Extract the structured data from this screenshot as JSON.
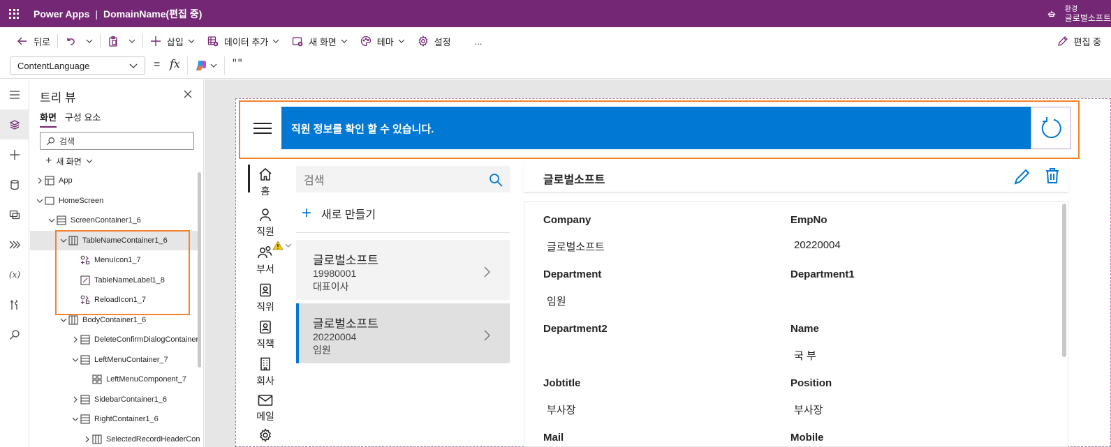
{
  "titlebar": {
    "app_name": "Power Apps",
    "separator": "|",
    "doc_name": "DomainName(편집 중)",
    "env_label": "환경",
    "env_name": "글로벌소프트"
  },
  "toolbar": {
    "back": "뒤로",
    "insert": "삽입",
    "add_data": "데이터 추가",
    "new_screen": "새 화면",
    "theme": "테마",
    "settings": "설정",
    "more": "...",
    "editing": "편집 중"
  },
  "formula": {
    "property": "ContentLanguage",
    "equals": "=",
    "fx": "fx",
    "value": "\"\""
  },
  "tree": {
    "title": "트리 뷰",
    "tabs": [
      "화면",
      "구성 요소"
    ],
    "search_placeholder": "검색",
    "new_screen": "새 화면",
    "rows": [
      {
        "label": "App",
        "indent": 0,
        "chev": "right",
        "icon": "app"
      },
      {
        "label": "HomeScreen",
        "indent": 0,
        "chev": "down",
        "icon": "screen"
      },
      {
        "label": "ScreenContainer1_6",
        "indent": 1,
        "chev": "down",
        "icon": "vcontainer"
      },
      {
        "label": "TableNameContainer1_6",
        "indent": 2,
        "chev": "down",
        "icon": "hcontainer",
        "selected": true
      },
      {
        "label": "MenuIcon1_7",
        "indent": 3,
        "chev": "",
        "icon": "iconctl"
      },
      {
        "label": "TableNameLabel1_8",
        "indent": 3,
        "chev": "",
        "icon": "label"
      },
      {
        "label": "ReloadIcon1_7",
        "indent": 3,
        "chev": "",
        "icon": "iconctl"
      },
      {
        "label": "BodyContainer1_6",
        "indent": 2,
        "chev": "down",
        "icon": "hcontainer"
      },
      {
        "label": "DeleteConfirmDialogContainer",
        "indent": 3,
        "chev": "right",
        "icon": "vcontainer"
      },
      {
        "label": "LeftMenuContainer_7",
        "indent": 3,
        "chev": "down",
        "icon": "vcontainer"
      },
      {
        "label": "LeftMenuComponent_7",
        "indent": 4,
        "chev": "",
        "icon": "component"
      },
      {
        "label": "SidebarContainer1_6",
        "indent": 3,
        "chev": "right",
        "icon": "vcontainer"
      },
      {
        "label": "RightContainer1_6",
        "indent": 3,
        "chev": "down",
        "icon": "vcontainer"
      },
      {
        "label": "SelectedRecordHeaderCon",
        "indent": 4,
        "chev": "right",
        "icon": "hcontainer"
      }
    ]
  },
  "app": {
    "header_title": "직원 정보를 확인 할 수 있습니다.",
    "menu": [
      "홈",
      "직원",
      "부서",
      "직위",
      "직책",
      "회사",
      "메일"
    ],
    "search_placeholder": "검색",
    "new_button": "새로 만들기",
    "records": [
      {
        "title": "글로벌소프트",
        "sub": "19980001",
        "sub2": "대표이사",
        "selected": false
      },
      {
        "title": "글로벌소프트",
        "sub": "20220004",
        "sub2": "임원",
        "selected": true
      }
    ],
    "detail_title": "글로벌소프트",
    "fields": [
      {
        "label": "Company",
        "value": "글로벌소프트"
      },
      {
        "label": "EmpNo",
        "value": "20220004"
      },
      {
        "label": "Department",
        "value": "임원"
      },
      {
        "label": "Department1",
        "value": ""
      },
      {
        "label": "Department2",
        "value": ""
      },
      {
        "label": "Name",
        "value": "국 부"
      },
      {
        "label": "Jobtitle",
        "value": "부사장"
      },
      {
        "label": "Position",
        "value": "부사장"
      },
      {
        "label": "Mail",
        "value": ""
      },
      {
        "label": "Mobile",
        "value": ""
      }
    ]
  },
  "colors": {
    "brand": "#742774",
    "accent": "#0078d4",
    "highlight": "#f6822a",
    "warning": "#f2c811"
  }
}
